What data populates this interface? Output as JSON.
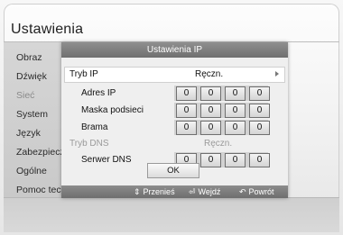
{
  "screen_title": "Ustawienia",
  "side_menu": [
    {
      "label": "Obraz",
      "state": "normal"
    },
    {
      "label": "Dźwięk",
      "state": "normal"
    },
    {
      "label": "Sieć",
      "state": "selected"
    },
    {
      "label": "System",
      "state": "normal"
    },
    {
      "label": "Język",
      "state": "normal"
    },
    {
      "label": "Zabezpiecz",
      "state": "normal"
    },
    {
      "label": "Ogólne",
      "state": "normal"
    },
    {
      "label": "Pomoc tech",
      "state": "normal"
    }
  ],
  "dialog": {
    "title": "Ustawienia IP",
    "ip_mode": {
      "label": "Tryb IP",
      "value": "Ręczn."
    },
    "ip_address": {
      "label": "Adres IP",
      "octets": [
        "0",
        "0",
        "0",
        "0"
      ]
    },
    "subnet_mask": {
      "label": "Maska podsieci",
      "octets": [
        "0",
        "0",
        "0",
        "0"
      ]
    },
    "gateway": {
      "label": "Brama",
      "octets": [
        "0",
        "0",
        "0",
        "0"
      ]
    },
    "dns_mode": {
      "label": "Tryb DNS",
      "value": "Ręczn.",
      "enabled": false
    },
    "dns_server": {
      "label": "Serwer DNS",
      "octets": [
        "0",
        "0",
        "0",
        "0"
      ]
    },
    "ok_label": "OK",
    "footer": {
      "move": {
        "icon": "up-down-arrows-icon",
        "glyph": "⇕",
        "label": "Przenieś"
      },
      "enter": {
        "icon": "enter-icon",
        "glyph": "⏎",
        "label": "Wejdź"
      },
      "back": {
        "icon": "return-icon",
        "glyph": "↶",
        "label": "Powrót"
      }
    }
  },
  "colors": {
    "dialog_header": "#7a7a7a",
    "highlight_row": "#ffffff",
    "disabled_text": "#9a9a9a"
  }
}
